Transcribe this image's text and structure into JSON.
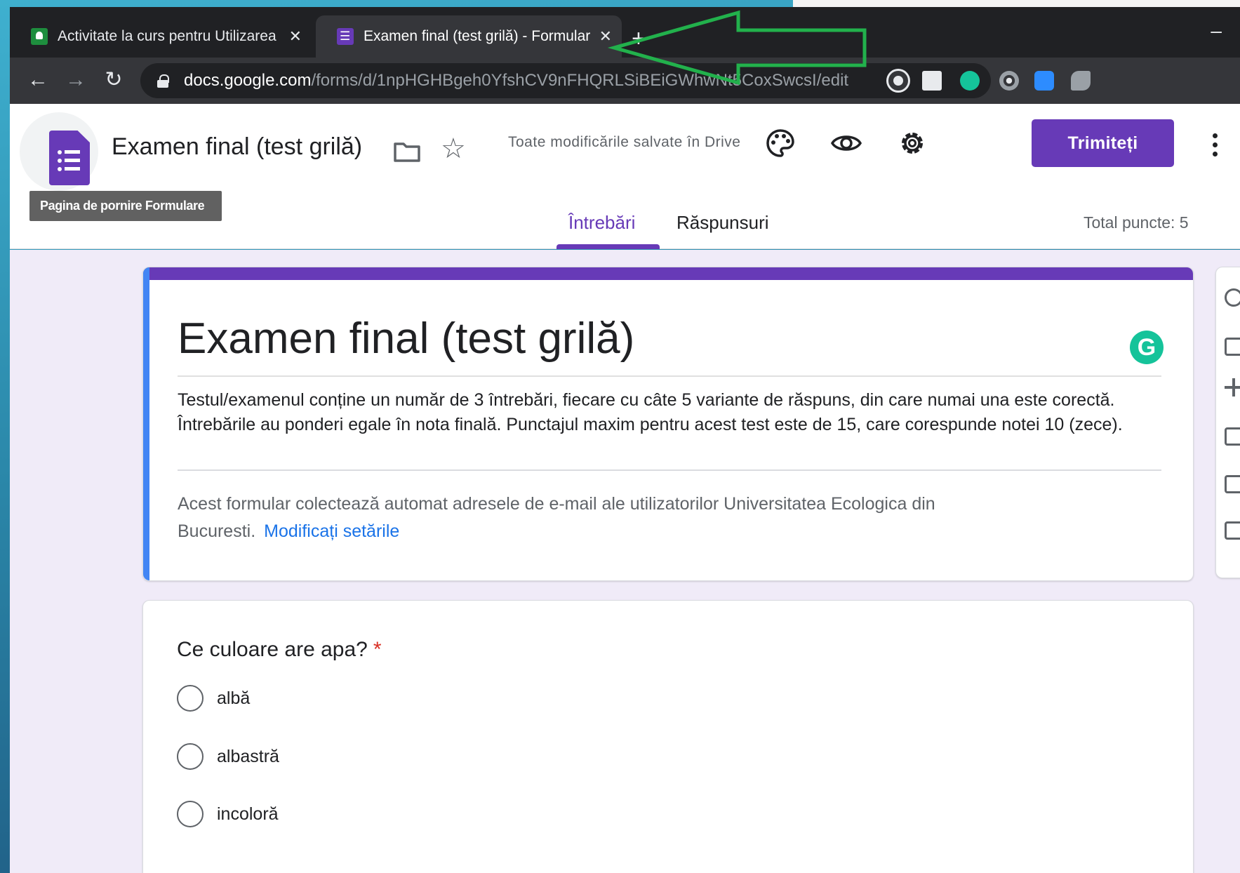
{
  "browser": {
    "tabs": [
      {
        "title": "Activitate la curs pentru Utilizarea",
        "close": "✕",
        "icon": "classroom-icon"
      },
      {
        "title": "Examen final (test grilă) - Formulare",
        "close": "✕",
        "icon": "forms-icon"
      }
    ],
    "new_tab": "+",
    "minimize": "–",
    "url_host": "docs.google.com",
    "url_path": "/forms/d/1npHGHBgeh0YfshCV9nFHQRLSiBEiGWhwNt5CoxSwcsI/edit",
    "annotation_arrow_color": "#22b14c"
  },
  "header": {
    "doc_title": "Examen final (test grilă)",
    "save_status": "Toate modificările salvate în Drive",
    "send_label": "Trimiteți",
    "tooltip": "Pagina de pornire Formulare",
    "tabs": [
      "Întrebări",
      "Răspunsuri"
    ],
    "total_points": "Total puncte: 5",
    "accent": "#673ab7"
  },
  "form": {
    "title": "Examen final (test grilă)",
    "description": "Testul/examenul conține un număr de 3 întrebări, fiecare cu câte 5 variante de răspuns, din care numai una este corectă. Întrebările au ponderi egale în nota finală. Punctajul maxim pentru acest test este de 15, care corespunde notei 10 (zece).",
    "email_note": "Acest formular colectează automat adresele de e-mail ale utilizatorilor Universitatea Ecologica din Bucuresti.",
    "email_link": "Modificați setările",
    "grammarly_badge": "G"
  },
  "question": {
    "title": "Ce culoare are apa?",
    "required_mark": "*",
    "options": [
      "albă",
      "albastră",
      "incoloră"
    ]
  }
}
